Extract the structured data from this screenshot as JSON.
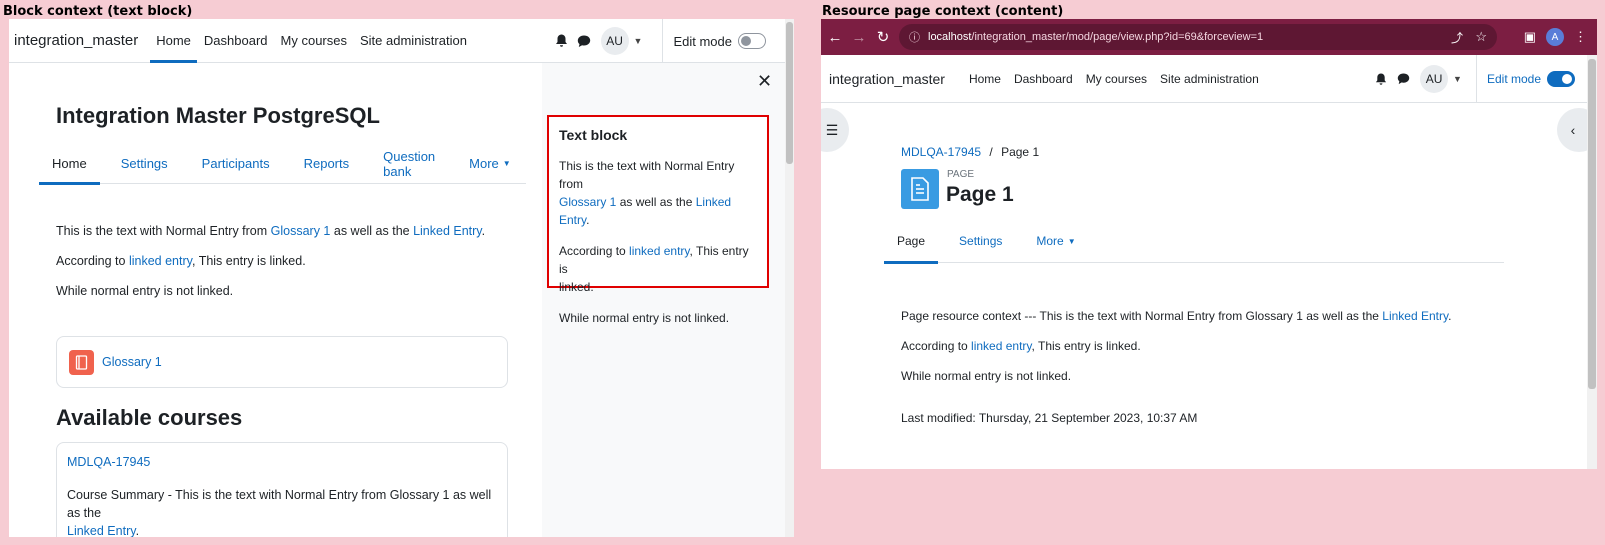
{
  "captions": {
    "left": "Block context (text block)",
    "right": "Resource page context (content)"
  },
  "left": {
    "nav": {
      "brand": "integration_master",
      "links": [
        "Home",
        "Dashboard",
        "My courses",
        "Site administration"
      ],
      "avatar": "AU",
      "edit_mode": "Edit mode"
    },
    "page_title": "Integration Master PostgreSQL",
    "tabs": [
      "Home",
      "Settings",
      "Participants",
      "Reports",
      "Question bank",
      "More"
    ],
    "content": {
      "p1_a": "This is the text with Normal Entry from ",
      "p1_link1": "Glossary 1",
      "p1_b": " as well as the ",
      "p1_link2": "Linked Entry",
      "p1_c": ".",
      "p2_a": "According to ",
      "p2_link": "linked entry",
      "p2_b": ", This entry is linked.",
      "p3": "While normal entry is not linked."
    },
    "glossary_card": {
      "label": "Glossary 1"
    },
    "available_courses": {
      "heading": "Available courses",
      "course_name": "MDLQA-17945",
      "summary_a": "Course Summary - This is the text with Normal Entry from Glossary 1 as well as the",
      "summary_link": "Linked Entry",
      "summary_b": "."
    },
    "text_block": {
      "title": "Text block",
      "p1_a": "This is the text with Normal Entry from",
      "p1_link1": "Glossary 1",
      "p1_b": " as well as the ",
      "p1_link2": "Linked Entry",
      "p1_c": ".",
      "p2_a": "According to ",
      "p2_link": "linked entry",
      "p2_b": ", This entry is",
      "p2_c": "linked.",
      "p3": "While normal entry is not linked."
    }
  },
  "right": {
    "browser": {
      "url_host": "localhost",
      "url_path": "/integration_master/mod/page/view.php?id=69&forceview=1",
      "profile": "A"
    },
    "nav": {
      "brand": "integration_master",
      "links": [
        "Home",
        "Dashboard",
        "My courses",
        "Site administration"
      ],
      "avatar": "AU",
      "edit_mode": "Edit mode"
    },
    "breadcrumb": {
      "course": "MDLQA-17945",
      "sep": "/",
      "page": "Page 1"
    },
    "activity_type": "PAGE",
    "page_title": "Page 1",
    "tabs": [
      "Page",
      "Settings",
      "More"
    ],
    "content": {
      "p1_a": "Page resource context --- This is the text with Normal Entry from Glossary 1 as well as the ",
      "p1_link": "Linked Entry",
      "p1_b": ".",
      "p2_a": "According to ",
      "p2_link": "linked entry",
      "p2_b": ", This entry is linked.",
      "p3": "While normal entry is not linked.",
      "last_modified": "Last modified: Thursday, 21 September 2023, 10:37 AM"
    }
  },
  "colors": {
    "background": "#f6ccd3",
    "link": "#0f6cbf",
    "highlight_border": "#e00000",
    "browser_bar": "#7c1e42"
  }
}
